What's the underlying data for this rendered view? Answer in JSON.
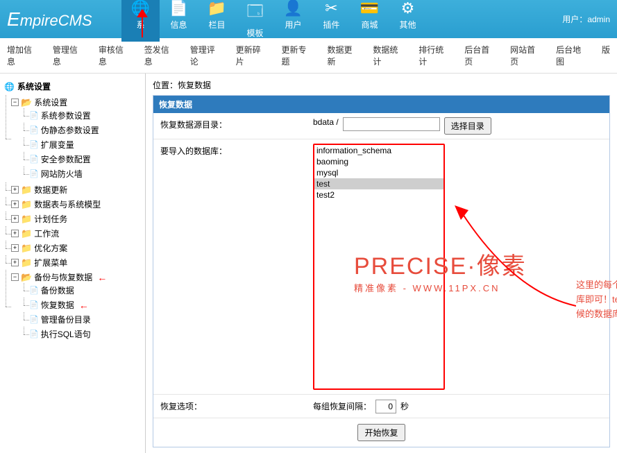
{
  "header": {
    "logo_prefix": "E",
    "logo_rest": "mpireCMS",
    "user_label": "用户：",
    "user_name": "admin",
    "nav": [
      {
        "label": "系",
        "icon": "🌐"
      },
      {
        "label": "信息",
        "icon": "📄"
      },
      {
        "label": "栏目",
        "icon": "📁"
      },
      {
        "label": "模板",
        "icon": "🗔"
      },
      {
        "label": "用户",
        "icon": "👤"
      },
      {
        "label": "插件",
        "icon": "✂"
      },
      {
        "label": "商城",
        "icon": "💳"
      },
      {
        "label": "其他",
        "icon": "⚙"
      }
    ]
  },
  "subnav": [
    "增加信息",
    "管理信息",
    "审核信息",
    "签发信息",
    "管理评论",
    "更新碎片",
    "更新专题",
    "数据更新",
    "数据统计",
    "排行统计",
    "后台首页",
    "网站首页",
    "后台地图",
    "版"
  ],
  "sidebar": {
    "title": "系统设置",
    "root": {
      "label": "系统设置",
      "children": [
        "系统参数设置",
        "伪静态参数设置",
        "扩展变量",
        "安全参数配置",
        "网站防火墙"
      ]
    },
    "folders": [
      "数据更新",
      "数据表与系统模型",
      "计划任务",
      "工作流",
      "优化方案",
      "扩展菜单"
    ],
    "backup": {
      "label": "备份与恢复数据",
      "children": [
        "备份数据",
        "恢复数据",
        "管理备份目录",
        "执行SQL语句"
      ]
    }
  },
  "content": {
    "breadcrumb_prefix": "位置：",
    "breadcrumb_page": "恢复数据",
    "panel_title": "恢复数据",
    "row1_label": "恢复数据源目录：",
    "row1_prefix": "bdata /",
    "row1_button": "选择目录",
    "row2_label": "要导入的数据库：",
    "databases": [
      "information_schema",
      "baoming",
      "mysql",
      "test",
      "test2"
    ],
    "selected_db": "test",
    "row3_label": "恢复选项：",
    "row3_text": "每组恢复间隔：",
    "row3_value": "0",
    "row3_unit": "秒",
    "submit": "开始恢复"
  },
  "watermark": {
    "big": "PRECISE·像素",
    "small": "精准像素 - WWW.11PX.CN"
  },
  "annotation": "这里的每个人显示的都不一样，选好你的数据库即可！test是我的数据库！也就是安装的时候的数据库！"
}
